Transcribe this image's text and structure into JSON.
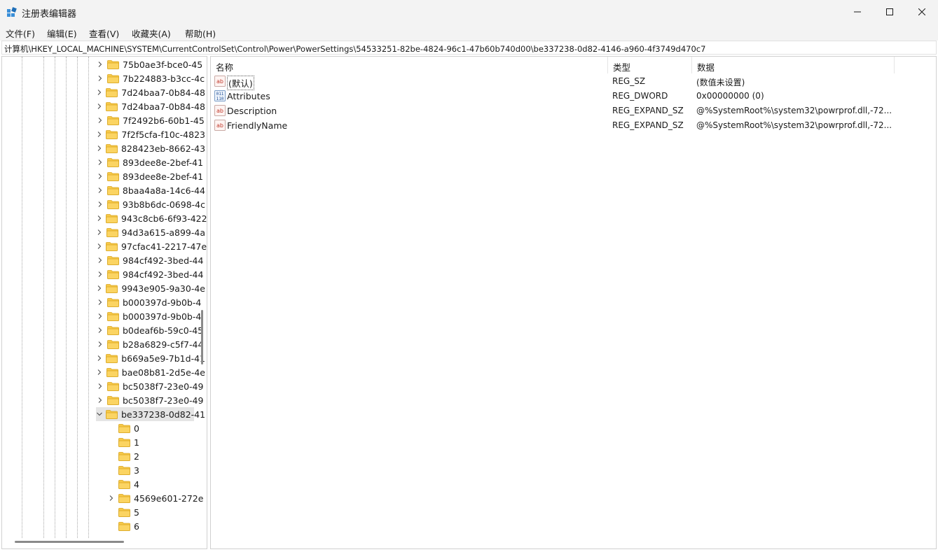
{
  "window": {
    "title": "注册表编辑器",
    "icon": "registry-editor-icon",
    "buttons": [
      "minimize-icon",
      "maximize-icon",
      "close-icon"
    ]
  },
  "menu": [
    {
      "label": "文件(F)"
    },
    {
      "label": "编辑(E)"
    },
    {
      "label": "查看(V)"
    },
    {
      "label": "收藏夹(A)"
    },
    {
      "label": "帮助(H)"
    }
  ],
  "address": "计算机\\HKEY_LOCAL_MACHINE\\SYSTEM\\CurrentControlSet\\Control\\Power\\PowerSettings\\54533251-82be-4824-96c1-47b60b740d00\\be337238-0d82-4146-a960-4f3749d470c7",
  "tree": {
    "items": [
      {
        "label": "75b0ae3f-bce0-45",
        "expandable": true
      },
      {
        "label": "7b224883-b3cc-4c",
        "expandable": true
      },
      {
        "label": "7d24baa7-0b84-48",
        "expandable": true
      },
      {
        "label": "7d24baa7-0b84-48",
        "expandable": true
      },
      {
        "label": "7f2492b6-60b1-45",
        "expandable": true
      },
      {
        "label": "7f2f5cfa-f10c-4823",
        "expandable": true
      },
      {
        "label": "828423eb-8662-43",
        "expandable": true
      },
      {
        "label": "893dee8e-2bef-41",
        "expandable": true
      },
      {
        "label": "893dee8e-2bef-41",
        "expandable": true
      },
      {
        "label": "8baa4a8a-14c6-44",
        "expandable": true
      },
      {
        "label": "93b8b6dc-0698-4c",
        "expandable": true
      },
      {
        "label": "943c8cb6-6f93-422",
        "expandable": true
      },
      {
        "label": "94d3a615-a899-4a",
        "expandable": true
      },
      {
        "label": "97cfac41-2217-47e",
        "expandable": true
      },
      {
        "label": "984cf492-3bed-44",
        "expandable": true
      },
      {
        "label": "984cf492-3bed-44",
        "expandable": true
      },
      {
        "label": "9943e905-9a30-4e",
        "expandable": true
      },
      {
        "label": "b000397d-9b0b-4",
        "expandable": true
      },
      {
        "label": "b000397d-9b0b-4",
        "expandable": true
      },
      {
        "label": "b0deaf6b-59c0-45",
        "expandable": true
      },
      {
        "label": "b28a6829-c5f7-44",
        "expandable": true
      },
      {
        "label": "b669a5e9-7b1d-41",
        "expandable": true
      },
      {
        "label": "bae08b81-2d5e-4e",
        "expandable": true
      },
      {
        "label": "bc5038f7-23e0-49",
        "expandable": true
      },
      {
        "label": "bc5038f7-23e0-49",
        "expandable": true
      },
      {
        "label": "be337238-0d82-41",
        "expandable": true,
        "expanded": true,
        "selected": true
      },
      {
        "label": "0",
        "expandable": false,
        "child": true
      },
      {
        "label": "1",
        "expandable": false,
        "child": true
      },
      {
        "label": "2",
        "expandable": false,
        "child": true
      },
      {
        "label": "3",
        "expandable": false,
        "child": true
      },
      {
        "label": "4",
        "expandable": false,
        "child": true
      },
      {
        "label": "4569e601-272e",
        "expandable": true,
        "child": true
      },
      {
        "label": "5",
        "expandable": false,
        "child": true
      },
      {
        "label": "6",
        "expandable": false,
        "child": true
      }
    ]
  },
  "list": {
    "columns": {
      "name": "名称",
      "type": "类型",
      "data": "数据"
    },
    "rows": [
      {
        "name": "(默认)",
        "type": "REG_SZ",
        "data": "(数值未设置)",
        "icon": "string-value-icon",
        "default": true
      },
      {
        "name": "Attributes",
        "type": "REG_DWORD",
        "data": "0x00000000 (0)",
        "icon": "binary-value-icon"
      },
      {
        "name": "Description",
        "type": "REG_EXPAND_SZ",
        "data": "@%SystemRoot%\\system32\\powrprof.dll,-72...",
        "icon": "string-value-icon"
      },
      {
        "name": "FriendlyName",
        "type": "REG_EXPAND_SZ",
        "data": "@%SystemRoot%\\system32\\powrprof.dll,-72...",
        "icon": "string-value-icon"
      }
    ]
  },
  "colors": {
    "folder": "#f7c948",
    "selection": "#e5e5e5",
    "titlebar": "#f3f3f3",
    "accent": "#0067c0"
  }
}
